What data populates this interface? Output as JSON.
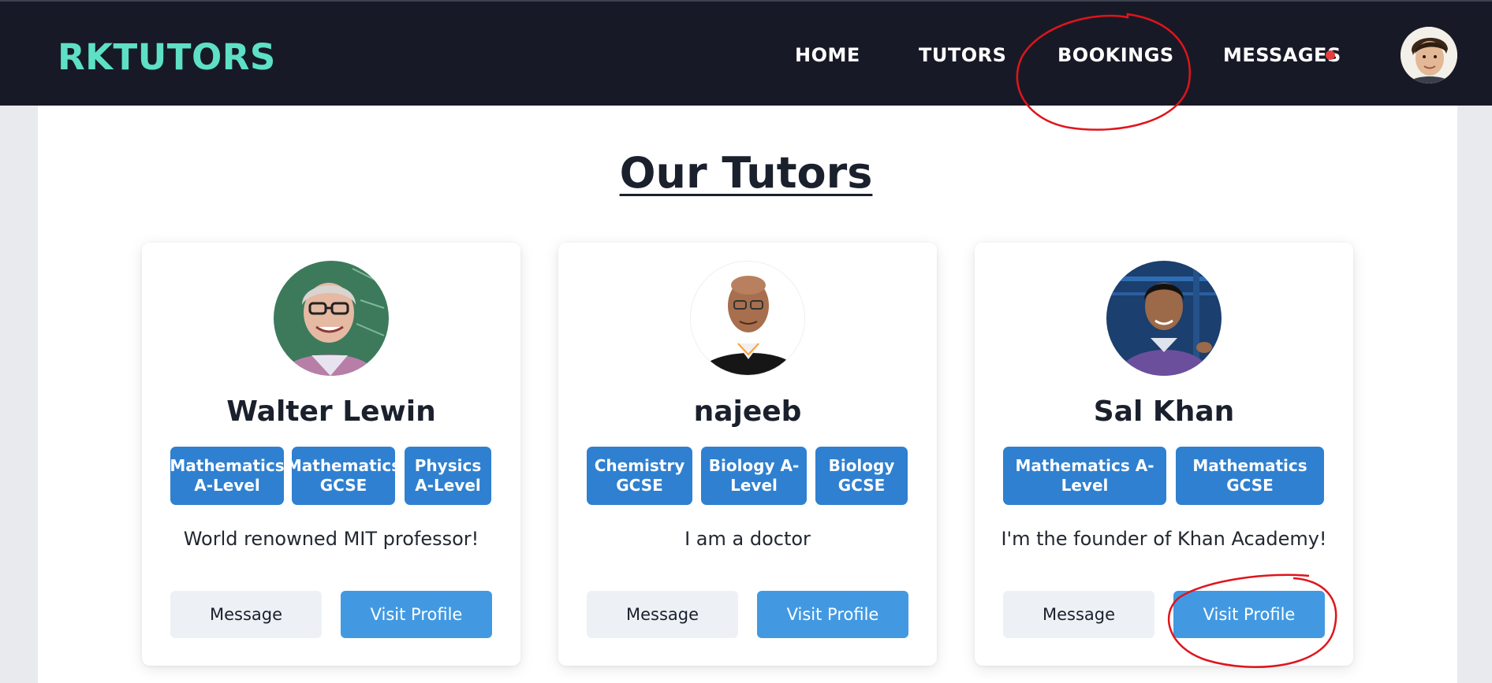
{
  "header": {
    "brand": "RKTUTORS",
    "nav": {
      "home": "HOME",
      "tutors": "TUTORS",
      "bookings": "BOOKINGS",
      "messages": "MESSAGES"
    },
    "brand_color": "#5ee0c6",
    "notification_color": "#e53e3e"
  },
  "page": {
    "title": "Our Tutors"
  },
  "tutors": [
    {
      "name": "Walter Lewin",
      "subjects": [
        "Mathematics A-Level",
        "Mathematics GCSE",
        "Physics A-Level"
      ],
      "bio": "World renowned MIT professor!",
      "message_label": "Message",
      "visit_label": "Visit Profile"
    },
    {
      "name": "najeeb",
      "subjects": [
        "Chemistry GCSE",
        "Biology A-Level",
        "Biology GCSE"
      ],
      "bio": "I am a doctor",
      "message_label": "Message",
      "visit_label": "Visit Profile"
    },
    {
      "name": "Sal Khan",
      "subjects": [
        "Mathematics A-Level",
        "Mathematics GCSE"
      ],
      "bio": "I'm the founder of Khan Academy!",
      "message_label": "Message",
      "visit_label": "Visit Profile"
    }
  ],
  "colors": {
    "header_bg": "#171a26",
    "tag_bg": "#2f80d0",
    "primary_button": "#4299e1",
    "secondary_button": "#edf1f6",
    "annotation": "#e0141c"
  }
}
